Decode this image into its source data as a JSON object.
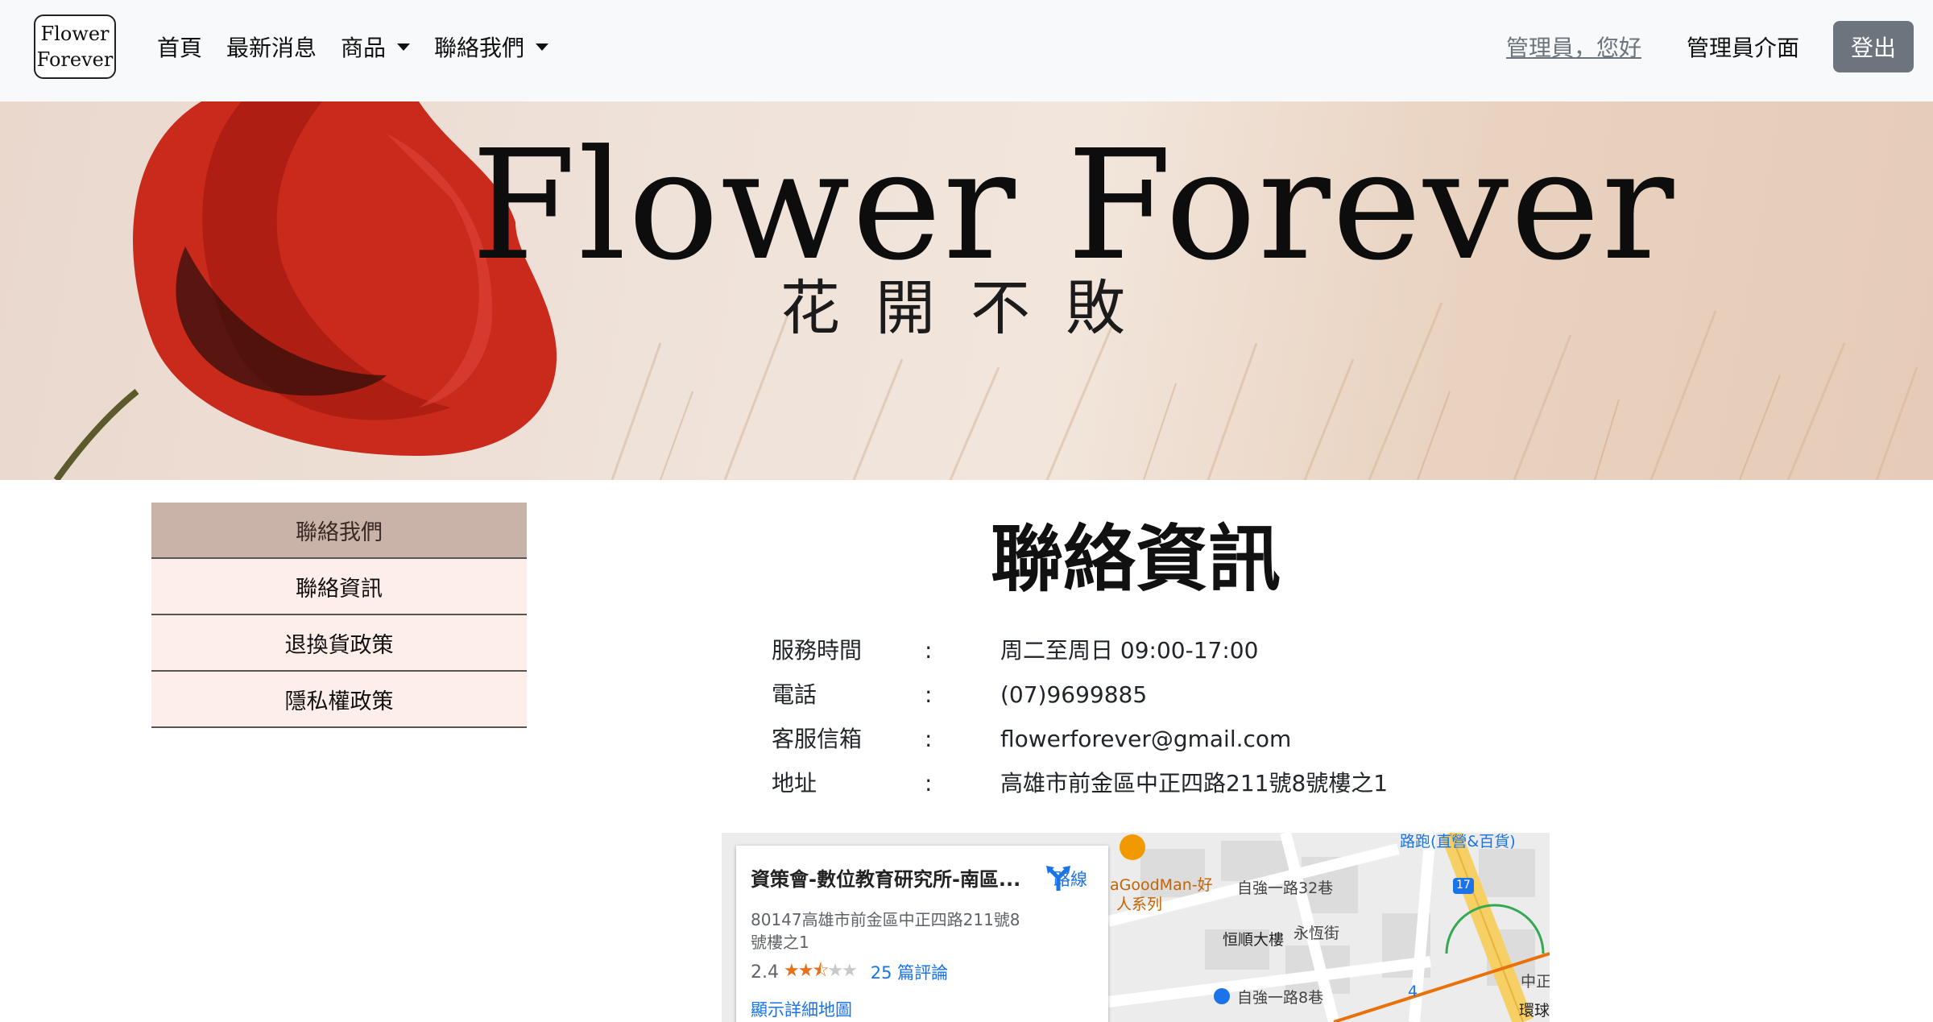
{
  "navbar": {
    "brand_line1": "Flower",
    "brand_line2": "Forever",
    "links": [
      "首頁",
      "最新消息",
      "商品",
      "聯絡我們"
    ],
    "greeting": "管理員，您好",
    "admin_link": "管理員介面",
    "logout": "登出"
  },
  "banner": {
    "title": "Flower Forever",
    "subtitle": "花開不敗"
  },
  "sidebar": {
    "items": [
      "聯絡我們",
      "聯絡資訊",
      "退換貨政策",
      "隱私權政策"
    ]
  },
  "contact": {
    "title": "聯絡資訊",
    "colon": ":",
    "rows": [
      {
        "label": "服務時間",
        "value": "周二至周日 09:00-17:00"
      },
      {
        "label": "電話",
        "value": "(07)9699885"
      },
      {
        "label": "客服信箱",
        "value": "flowerforever@gmail.com"
      },
      {
        "label": "地址",
        "value": "高雄市前金區中正四路211號8號樓之1"
      }
    ]
  },
  "map": {
    "place_name": "資策會-數位教育研究所-南區...",
    "address": "80147高雄市前金區中正四路211號8號樓之1",
    "directions": "路線",
    "rating": "2.4",
    "reviews": "25 篇評論",
    "more_link": "顯示詳細地圖",
    "labels": [
      "aGoodMan-好",
      "人系列",
      "自強一路32巷",
      "恒順大樓",
      "永恆街",
      "自強一路8巷",
      "4",
      "環球",
      "17",
      "中正",
      "路跑(直營&百貨)"
    ]
  },
  "colors": {
    "navbar_bg": "#f8f9fa",
    "logout_bg": "#6c757d",
    "sidebar_head": "#c9b3a9",
    "sidebar_item": "#fdeeea",
    "link_blue": "#1a73e8",
    "star_orange": "#e7711b"
  }
}
